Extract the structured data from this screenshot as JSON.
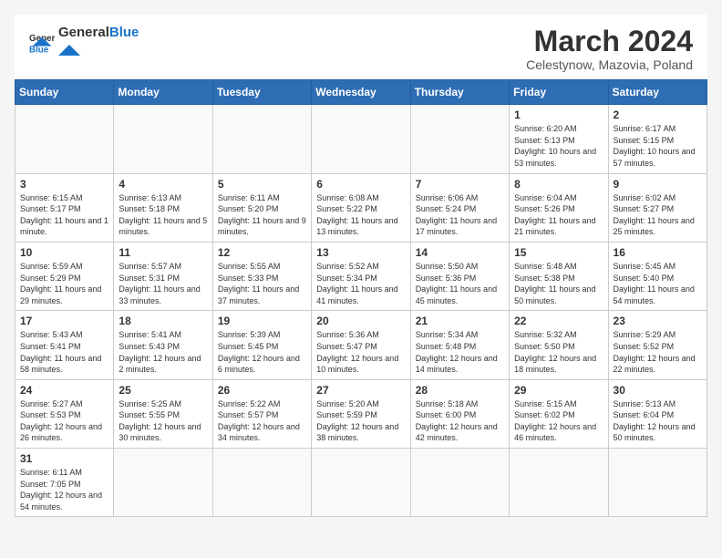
{
  "header": {
    "logo_general": "General",
    "logo_blue": "Blue",
    "month_title": "March 2024",
    "subtitle": "Celestynow, Mazovia, Poland"
  },
  "weekdays": [
    "Sunday",
    "Monday",
    "Tuesday",
    "Wednesday",
    "Thursday",
    "Friday",
    "Saturday"
  ],
  "weeks": [
    [
      {
        "day": "",
        "info": ""
      },
      {
        "day": "",
        "info": ""
      },
      {
        "day": "",
        "info": ""
      },
      {
        "day": "",
        "info": ""
      },
      {
        "day": "",
        "info": ""
      },
      {
        "day": "1",
        "info": "Sunrise: 6:20 AM\nSunset: 5:13 PM\nDaylight: 10 hours and 53 minutes."
      },
      {
        "day": "2",
        "info": "Sunrise: 6:17 AM\nSunset: 5:15 PM\nDaylight: 10 hours and 57 minutes."
      }
    ],
    [
      {
        "day": "3",
        "info": "Sunrise: 6:15 AM\nSunset: 5:17 PM\nDaylight: 11 hours and 1 minute."
      },
      {
        "day": "4",
        "info": "Sunrise: 6:13 AM\nSunset: 5:18 PM\nDaylight: 11 hours and 5 minutes."
      },
      {
        "day": "5",
        "info": "Sunrise: 6:11 AM\nSunset: 5:20 PM\nDaylight: 11 hours and 9 minutes."
      },
      {
        "day": "6",
        "info": "Sunrise: 6:08 AM\nSunset: 5:22 PM\nDaylight: 11 hours and 13 minutes."
      },
      {
        "day": "7",
        "info": "Sunrise: 6:06 AM\nSunset: 5:24 PM\nDaylight: 11 hours and 17 minutes."
      },
      {
        "day": "8",
        "info": "Sunrise: 6:04 AM\nSunset: 5:26 PM\nDaylight: 11 hours and 21 minutes."
      },
      {
        "day": "9",
        "info": "Sunrise: 6:02 AM\nSunset: 5:27 PM\nDaylight: 11 hours and 25 minutes."
      }
    ],
    [
      {
        "day": "10",
        "info": "Sunrise: 5:59 AM\nSunset: 5:29 PM\nDaylight: 11 hours and 29 minutes."
      },
      {
        "day": "11",
        "info": "Sunrise: 5:57 AM\nSunset: 5:31 PM\nDaylight: 11 hours and 33 minutes."
      },
      {
        "day": "12",
        "info": "Sunrise: 5:55 AM\nSunset: 5:33 PM\nDaylight: 11 hours and 37 minutes."
      },
      {
        "day": "13",
        "info": "Sunrise: 5:52 AM\nSunset: 5:34 PM\nDaylight: 11 hours and 41 minutes."
      },
      {
        "day": "14",
        "info": "Sunrise: 5:50 AM\nSunset: 5:36 PM\nDaylight: 11 hours and 45 minutes."
      },
      {
        "day": "15",
        "info": "Sunrise: 5:48 AM\nSunset: 5:38 PM\nDaylight: 11 hours and 50 minutes."
      },
      {
        "day": "16",
        "info": "Sunrise: 5:45 AM\nSunset: 5:40 PM\nDaylight: 11 hours and 54 minutes."
      }
    ],
    [
      {
        "day": "17",
        "info": "Sunrise: 5:43 AM\nSunset: 5:41 PM\nDaylight: 11 hours and 58 minutes."
      },
      {
        "day": "18",
        "info": "Sunrise: 5:41 AM\nSunset: 5:43 PM\nDaylight: 12 hours and 2 minutes."
      },
      {
        "day": "19",
        "info": "Sunrise: 5:39 AM\nSunset: 5:45 PM\nDaylight: 12 hours and 6 minutes."
      },
      {
        "day": "20",
        "info": "Sunrise: 5:36 AM\nSunset: 5:47 PM\nDaylight: 12 hours and 10 minutes."
      },
      {
        "day": "21",
        "info": "Sunrise: 5:34 AM\nSunset: 5:48 PM\nDaylight: 12 hours and 14 minutes."
      },
      {
        "day": "22",
        "info": "Sunrise: 5:32 AM\nSunset: 5:50 PM\nDaylight: 12 hours and 18 minutes."
      },
      {
        "day": "23",
        "info": "Sunrise: 5:29 AM\nSunset: 5:52 PM\nDaylight: 12 hours and 22 minutes."
      }
    ],
    [
      {
        "day": "24",
        "info": "Sunrise: 5:27 AM\nSunset: 5:53 PM\nDaylight: 12 hours and 26 minutes."
      },
      {
        "day": "25",
        "info": "Sunrise: 5:25 AM\nSunset: 5:55 PM\nDaylight: 12 hours and 30 minutes."
      },
      {
        "day": "26",
        "info": "Sunrise: 5:22 AM\nSunset: 5:57 PM\nDaylight: 12 hours and 34 minutes."
      },
      {
        "day": "27",
        "info": "Sunrise: 5:20 AM\nSunset: 5:59 PM\nDaylight: 12 hours and 38 minutes."
      },
      {
        "day": "28",
        "info": "Sunrise: 5:18 AM\nSunset: 6:00 PM\nDaylight: 12 hours and 42 minutes."
      },
      {
        "day": "29",
        "info": "Sunrise: 5:15 AM\nSunset: 6:02 PM\nDaylight: 12 hours and 46 minutes."
      },
      {
        "day": "30",
        "info": "Sunrise: 5:13 AM\nSunset: 6:04 PM\nDaylight: 12 hours and 50 minutes."
      }
    ],
    [
      {
        "day": "31",
        "info": "Sunrise: 6:11 AM\nSunset: 7:05 PM\nDaylight: 12 hours and 54 minutes."
      },
      {
        "day": "",
        "info": ""
      },
      {
        "day": "",
        "info": ""
      },
      {
        "day": "",
        "info": ""
      },
      {
        "day": "",
        "info": ""
      },
      {
        "day": "",
        "info": ""
      },
      {
        "day": "",
        "info": ""
      }
    ]
  ]
}
